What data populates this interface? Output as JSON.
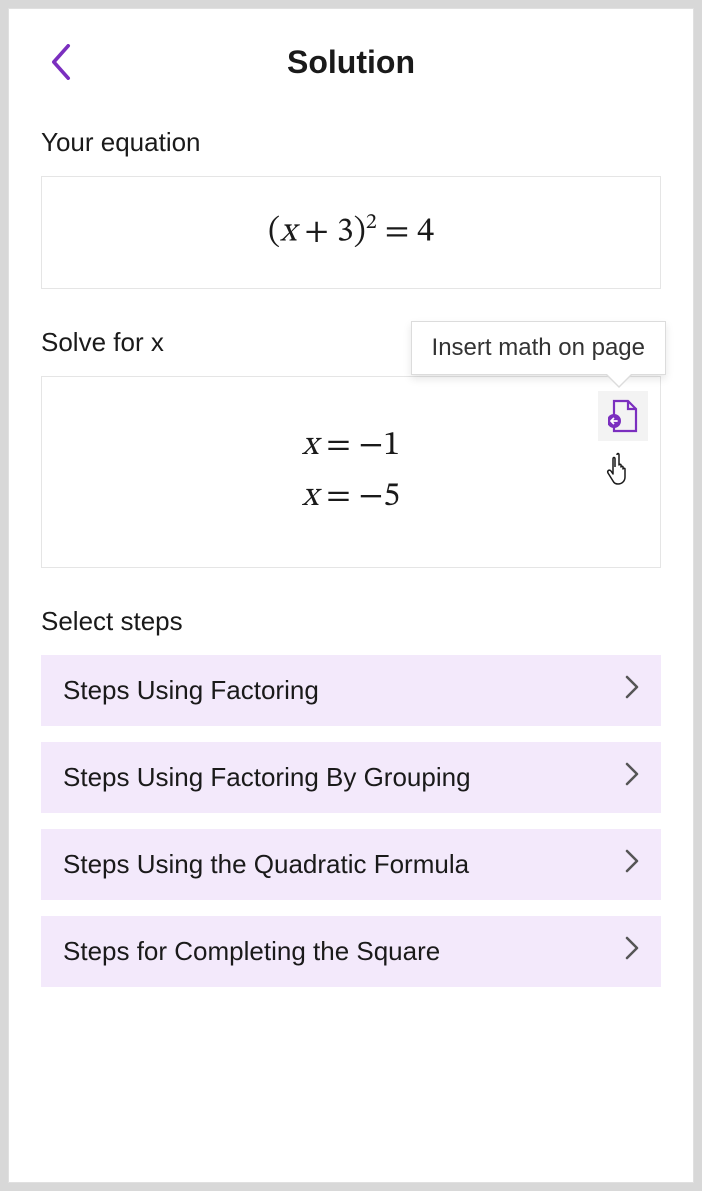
{
  "header": {
    "title": "Solution"
  },
  "equation_section": {
    "label": "Your equation",
    "equation_html": "(<i>x</i> + 3)<span class='sup'>2</span> = 4"
  },
  "solution_section": {
    "label": "Solve for x",
    "tooltip": "Insert math on page",
    "lines": [
      "x = −1",
      "x = −5"
    ]
  },
  "steps_section": {
    "label": "Select steps",
    "items": [
      "Steps Using Factoring",
      "Steps Using Factoring By Grouping",
      "Steps Using the Quadratic Formula",
      "Steps for Completing the Square"
    ]
  }
}
